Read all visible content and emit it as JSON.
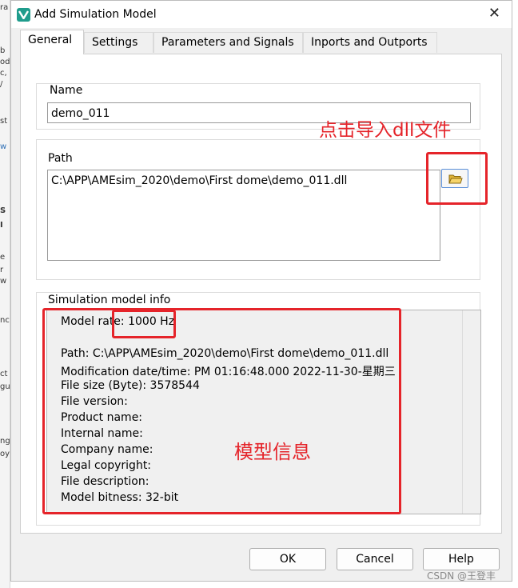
{
  "window": {
    "title": "Add Simulation Model",
    "close_glyph": "✕"
  },
  "tabs": [
    {
      "label": "General"
    },
    {
      "label": "Settings"
    },
    {
      "label": "Parameters and Signals"
    },
    {
      "label": "Inports and Outports"
    }
  ],
  "name_group": {
    "label": "Name",
    "value": "demo_011"
  },
  "path_group": {
    "label": "Path",
    "value": "C:\\APP\\AMEsim_2020\\demo\\First dome\\demo_011.dll",
    "browse_icon": "folder-icon"
  },
  "info_group": {
    "label": "Simulation model info",
    "model_rate_label": "Model rate:",
    "model_rate_value": "1000 Hz",
    "lines": [
      "Path: C:\\APP\\AMEsim_2020\\demo\\First dome\\demo_011.dll",
      "Modification date/time: PM 01:16:48.000 2022-11-30-星期三",
      "File size (Byte): 3578544",
      "File version:",
      "Product name:",
      "Internal name:",
      "Company name:",
      "Legal copyright:",
      "File description:",
      "Model bitness: 32-bit"
    ]
  },
  "buttons": {
    "ok": "OK",
    "cancel": "Cancel",
    "help": "Help"
  },
  "annotations": {
    "import_dll": "点击导入dll文件",
    "model_info": "模型信息",
    "color": "#e5242a"
  },
  "background_fragments": [
    "ra",
    "b",
    "od",
    "c,",
    "/",
    "st",
    "w",
    "S",
    "I",
    "e",
    "r",
    "w",
    "nc",
    "ct",
    "gu",
    "ng",
    "oy"
  ],
  "watermark": "CSDN @王登丰"
}
